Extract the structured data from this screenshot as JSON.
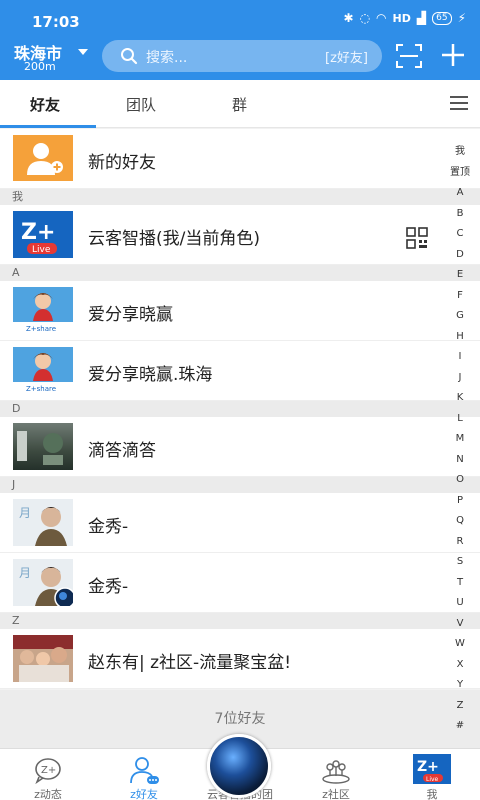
{
  "status": {
    "time": "17:03",
    "hd": "HD",
    "signal": "4G",
    "battery": "65"
  },
  "header": {
    "city": "珠海市",
    "distance": "200m",
    "search_placeholder": "搜索...",
    "search_tag": "[z好友]"
  },
  "tabs": [
    {
      "label": "好友",
      "active": true
    },
    {
      "label": "团队",
      "active": false
    },
    {
      "label": "群",
      "active": false
    }
  ],
  "list": {
    "new_friend": "新的好友",
    "section_me": "我",
    "me": "云客智播(我/当前角色)",
    "section_a": "A",
    "a1": "爱分享晓赢",
    "a2": "爱分享晓赢.珠海",
    "section_d": "D",
    "d1": "滴答滴答",
    "section_j": "J",
    "j1": "金秀-",
    "j2": "金秀-",
    "section_z": "Z",
    "z1": "赵东有| z社区-流量聚宝盆!"
  },
  "friend_count": "7位好友",
  "index_bar": [
    "我",
    "置顶",
    "A",
    "B",
    "C",
    "D",
    "E",
    "F",
    "G",
    "H",
    "I",
    "J",
    "K",
    "L",
    "M",
    "N",
    "O",
    "P",
    "Q",
    "R",
    "S",
    "T",
    "U",
    "V",
    "W",
    "X",
    "Y",
    "Z",
    "#"
  ],
  "bottom_nav": [
    {
      "label": "z动态",
      "icon": "zplus-chat-icon"
    },
    {
      "label": "z好友",
      "icon": "contacts-icon",
      "active": true
    },
    {
      "label": "云客智播的团",
      "icon": "globe-icon"
    },
    {
      "label": "z社区",
      "icon": "community-icon"
    },
    {
      "label": "我",
      "icon": "zplus-live-logo"
    }
  ],
  "colors": {
    "accent": "#2f8ee8",
    "new_friend_orange": "#f5a13a",
    "live_blue": "#1565c0"
  }
}
